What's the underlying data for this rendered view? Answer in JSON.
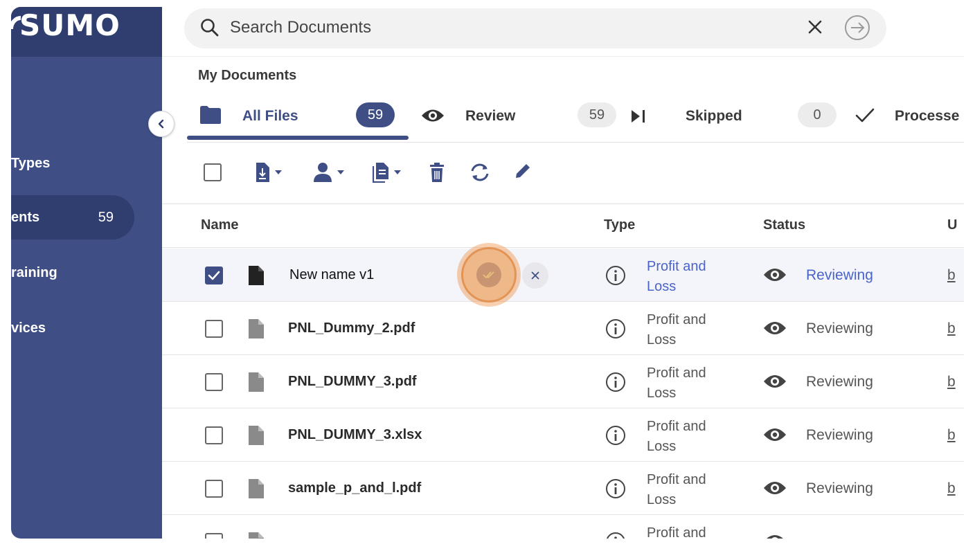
{
  "app": {
    "logo_text": "SUMO"
  },
  "sidebar": {
    "items": [
      {
        "label": "Types",
        "count": ""
      },
      {
        "label": "ents",
        "count": "59"
      },
      {
        "label": "raining",
        "count": ""
      },
      {
        "label": "vices",
        "count": ""
      }
    ]
  },
  "search": {
    "placeholder": "Search Documents",
    "value": ""
  },
  "breadcrumb": "My Documents",
  "tabs": [
    {
      "label": "All Files",
      "count": "59",
      "icon": "folder-icon"
    },
    {
      "label": "Review",
      "count": "59",
      "icon": "eye-icon"
    },
    {
      "label": "Skipped",
      "count": "0",
      "icon": "skip-icon"
    },
    {
      "label": "Processe",
      "icon": "check-icon"
    }
  ],
  "table": {
    "headers": {
      "name": "Name",
      "type": "Type",
      "status": "Status",
      "uploader": "U"
    },
    "rows": [
      {
        "name": "New name v1",
        "type_line1": "Profit and",
        "type_line2": "Loss",
        "status": "Reviewing",
        "uploader": "b",
        "checked": true,
        "editing": true
      },
      {
        "name": "PNL_Dummy_2.pdf",
        "type_line1": "Profit and",
        "type_line2": "Loss",
        "status": "Reviewing",
        "uploader": "b"
      },
      {
        "name": "PNL_DUMMY_3.pdf",
        "type_line1": "Profit and",
        "type_line2": "Loss",
        "status": "Reviewing",
        "uploader": "b"
      },
      {
        "name": "PNL_DUMMY_3.xlsx",
        "type_line1": "Profit and",
        "type_line2": "Loss",
        "status": "Reviewing",
        "uploader": "b"
      },
      {
        "name": "sample_p_and_l.pdf",
        "type_line1": "Profit and",
        "type_line2": "Loss",
        "status": "Reviewing",
        "uploader": "b"
      },
      {
        "name": "",
        "type_line1": "Profit and",
        "type_line2": "",
        "status": "",
        "uploader": ""
      }
    ]
  },
  "colors": {
    "sidebar": "#3f4f85",
    "sidebar_dark": "#2f3d6f",
    "link": "#4a63c9",
    "highlight": "#eeb888"
  }
}
